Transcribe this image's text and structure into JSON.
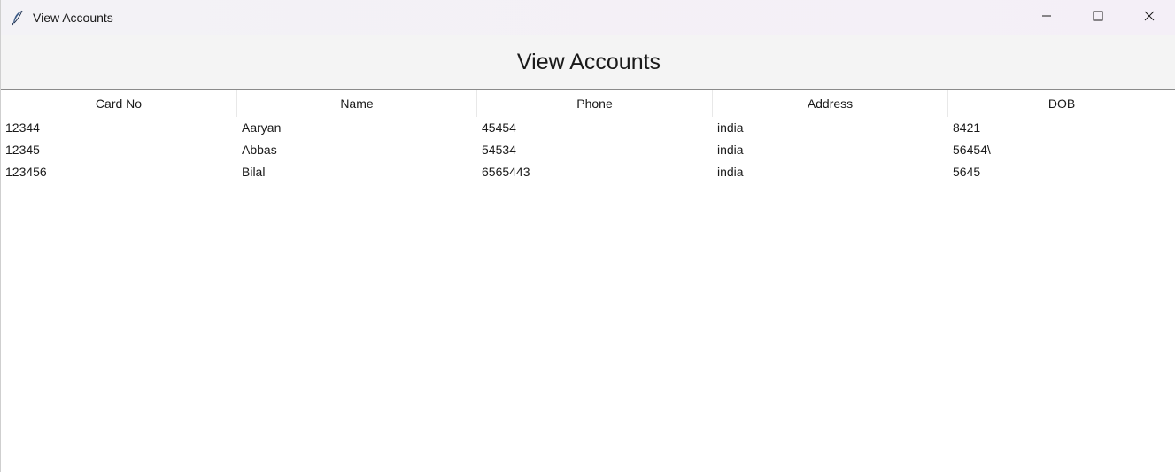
{
  "window": {
    "title": "View Accounts",
    "controls": {
      "minimize_icon": "minimize-icon",
      "maximize_icon": "maximize-icon",
      "close_icon": "close-icon"
    },
    "app_icon": "feather-icon"
  },
  "header": {
    "title": "View Accounts"
  },
  "table": {
    "columns": [
      "Card No",
      "Name",
      "Phone",
      "Address",
      "DOB"
    ],
    "rows": [
      [
        "12344",
        "Aaryan",
        "45454",
        "india",
        "8421"
      ],
      [
        "12345",
        "Abbas",
        "54534",
        "india",
        "56454\\"
      ],
      [
        "123456",
        "Bilal",
        "6565443",
        "india",
        "5645"
      ]
    ]
  },
  "colors": {
    "titlebar_bg": "#f3f2f6",
    "header_bg": "#f4f4f4",
    "table_bg": "#ffffff",
    "text": "#1a1a1a"
  }
}
